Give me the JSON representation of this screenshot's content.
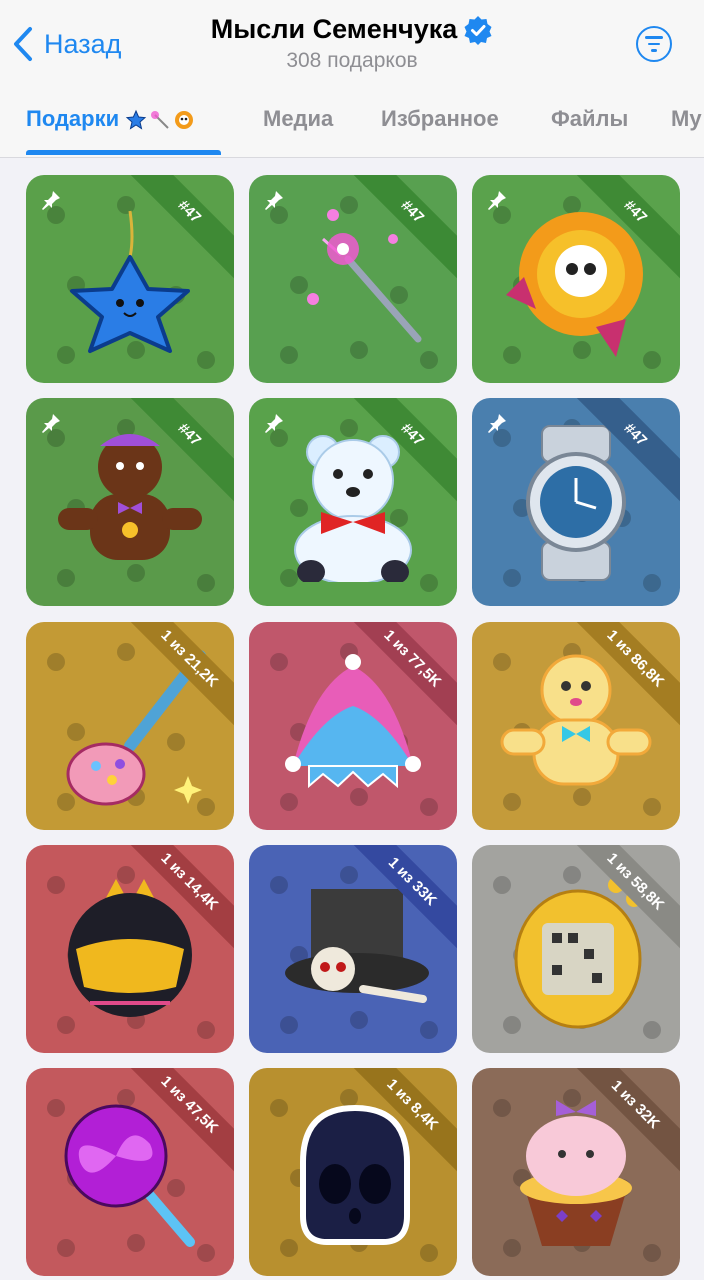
{
  "header": {
    "back_label": "Назад",
    "title": "Мысли Семенчука",
    "subtitle": "308 подарков"
  },
  "tabs": [
    {
      "label": "Подарки",
      "active": true
    },
    {
      "label": "Медиа",
      "active": false
    },
    {
      "label": "Избранное",
      "active": false
    },
    {
      "label": "Файлы",
      "active": false
    },
    {
      "label": "Му",
      "active": false
    }
  ],
  "colors": {
    "accent": "#1f88f0"
  },
  "gifts": [
    {
      "name": "blue-star-keychain-icon",
      "badge": "#47",
      "pinned": true,
      "bg": "#5aa04a",
      "ribbon": "#3f8a35"
    },
    {
      "name": "sparkler-icon",
      "badge": "#47",
      "pinned": true,
      "bg": "#58a050",
      "ribbon": "#3c8a35"
    },
    {
      "name": "skull-flower-icon",
      "badge": "#47",
      "pinned": true,
      "bg": "#5aa24c",
      "ribbon": "#3f8a35"
    },
    {
      "name": "gingerbread-cookie-icon",
      "badge": "#47",
      "pinned": true,
      "bg": "#5a9a4a",
      "ribbon": "#3f8a35"
    },
    {
      "name": "teddy-bear-icon",
      "badge": "#47",
      "pinned": true,
      "bg": "#59a24b",
      "ribbon": "#3f8a35"
    },
    {
      "name": "wrist-watch-icon",
      "badge": "#47",
      "pinned": true,
      "bg": "#4a7fae",
      "ribbon": "#355f8c"
    },
    {
      "name": "candy-bag-keychain-icon",
      "badge": "1 из 21,2K",
      "pinned": false,
      "bg": "#c39a35",
      "ribbon": "#a47d22"
    },
    {
      "name": "jester-hat-icon",
      "badge": "1 из 77,5K",
      "pinned": false,
      "bg": "#c0576b",
      "ribbon": "#a23f52"
    },
    {
      "name": "gingerbread-man-icon",
      "badge": "1 из 86,8K",
      "pinned": false,
      "bg": "#c49b3a",
      "ribbon": "#a47d22"
    },
    {
      "name": "cat-helmet-icon",
      "badge": "1 из 14,4K",
      "pinned": false,
      "bg": "#c4585c",
      "ribbon": "#a33e42"
    },
    {
      "name": "top-hat-icon",
      "badge": "1 из 33K",
      "pinned": false,
      "bg": "#4a63b5",
      "ribbon": "#3449a0"
    },
    {
      "name": "tamagotchi-icon",
      "badge": "1 из 58,8K",
      "pinned": false,
      "bg": "#a3a39f",
      "ribbon": "#8a8a85"
    },
    {
      "name": "lollipop-icon",
      "badge": "1 из 47,5K",
      "pinned": false,
      "bg": "#c3595d",
      "ribbon": "#a33e42"
    },
    {
      "name": "ghost-skull-icon",
      "badge": "1 из 8,4K",
      "pinned": false,
      "bg": "#b8902f",
      "ribbon": "#98741c"
    },
    {
      "name": "cupcake-icon",
      "badge": "1 из 32K",
      "pinned": false,
      "bg": "#8b6b58",
      "ribbon": "#735442"
    }
  ]
}
